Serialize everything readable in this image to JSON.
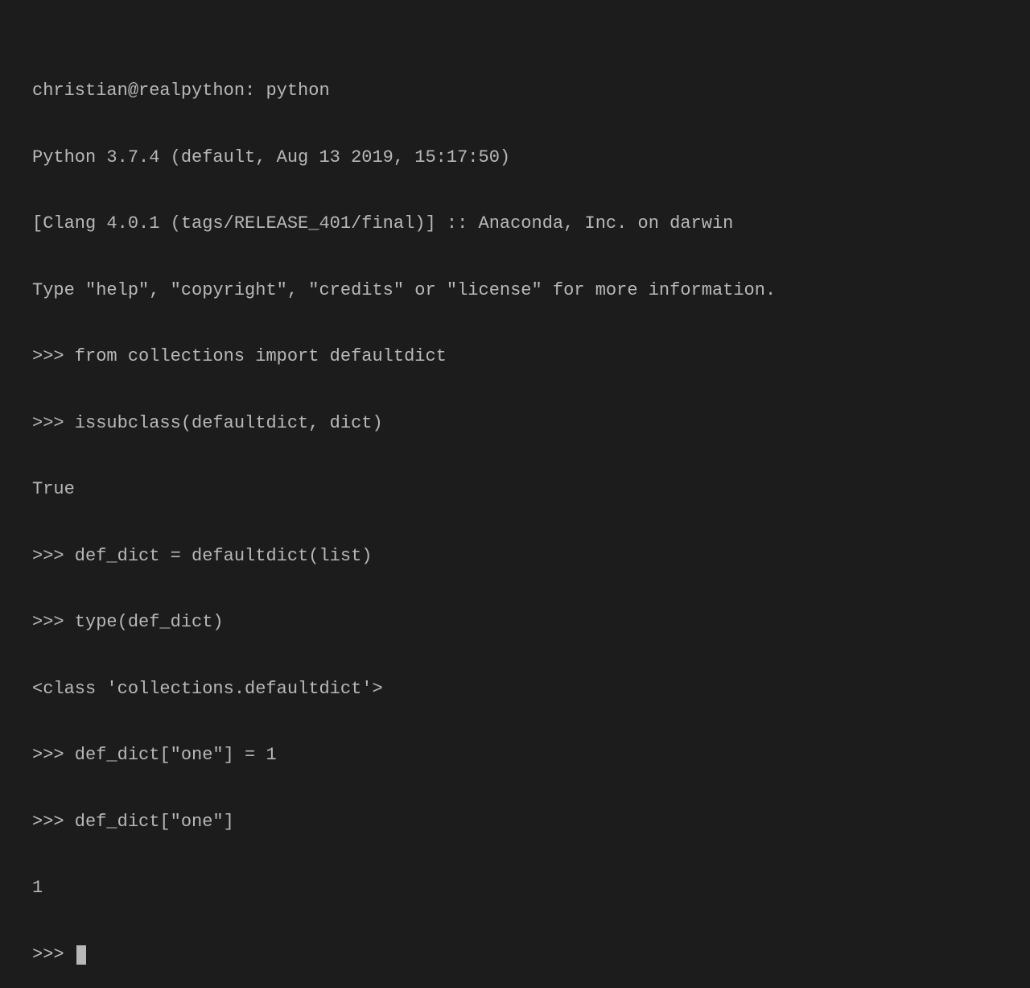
{
  "terminal": {
    "lines": [
      "christian@realpython: python",
      "Python 3.7.4 (default, Aug 13 2019, 15:17:50)",
      "[Clang 4.0.1 (tags/RELEASE_401/final)] :: Anaconda, Inc. on darwin",
      "Type \"help\", \"copyright\", \"credits\" or \"license\" for more information.",
      ">>> from collections import defaultdict",
      ">>> issubclass(defaultdict, dict)",
      "True",
      ">>> def_dict = defaultdict(list)",
      ">>> type(def_dict)",
      "<class 'collections.defaultdict'>",
      ">>> def_dict[\"one\"] = 1",
      ">>> def_dict[\"one\"]",
      "1"
    ],
    "prompt": ">>> "
  }
}
